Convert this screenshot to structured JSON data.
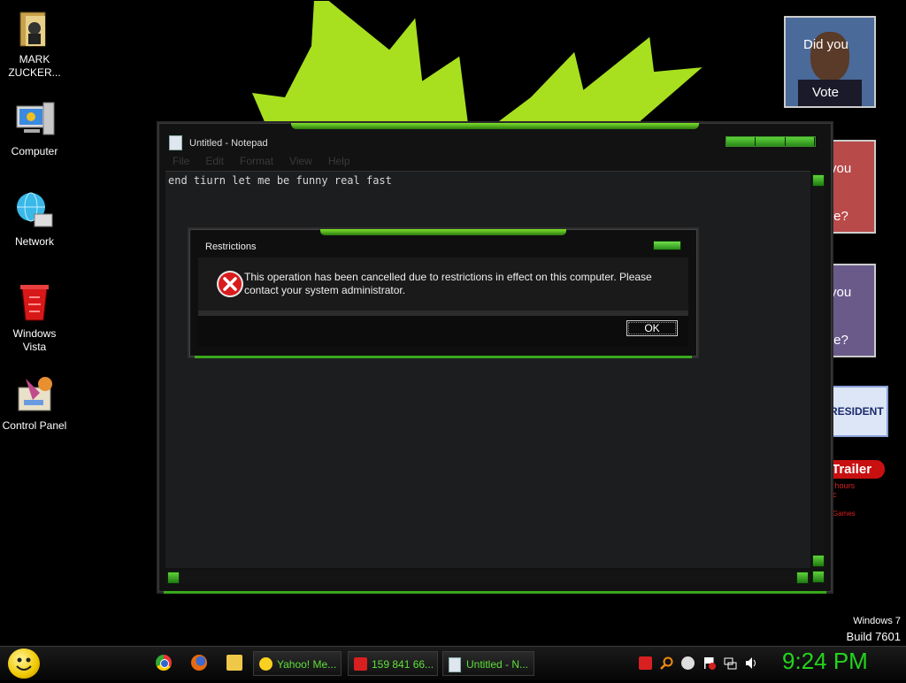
{
  "desktop": {
    "icons": [
      {
        "label": "MARK ZUCKER...",
        "icon": "folder-person-icon"
      },
      {
        "label": "Computer",
        "icon": "computer-icon"
      },
      {
        "label": "Network",
        "icon": "network-globe-icon"
      },
      {
        "label": "Windows Vista",
        "icon": "recycle-bin-icon"
      },
      {
        "label": "Control Panel",
        "icon": "control-panel-icon"
      }
    ],
    "gadgets": {
      "ad1_line1": "Did you",
      "ad1_line2": "Vote",
      "ad2_line1": "you",
      "ad2_line2": "te?",
      "ad3_line1": "you",
      "ad3_line2": "te?",
      "banner": "RESIDENT",
      "trailer": "Trailer",
      "trailer_sub1": "8 hours",
      "trailer_sub2": "ac",
      "trailer_sub3": "r Games"
    },
    "watermark": {
      "line1": "Windows 7",
      "line2": "Build 7601"
    }
  },
  "notepad": {
    "title": "Untitled - Notepad",
    "menu": [
      "File",
      "Edit",
      "Format",
      "View",
      "Help"
    ],
    "content": "end tiurn let me be funny real fast"
  },
  "dialog": {
    "title": "Restrictions",
    "message": "This operation has been cancelled due to restrictions in effect on this computer. Please contact your system administrator.",
    "ok_label": "OK",
    "icon": "error-icon"
  },
  "taskbar": {
    "quick_launch": [
      "chrome-icon",
      "firefox-icon",
      "folder-icon"
    ],
    "buttons": [
      {
        "label": "Yahoo! Me...",
        "icon": "yahoo-messenger-icon"
      },
      {
        "label": "159 841 66...",
        "icon": "media-player-icon"
      },
      {
        "label": "Untitled - N...",
        "icon": "notepad-icon"
      }
    ],
    "clock": "9:24 PM"
  },
  "colors": {
    "accent": "#5fe03a",
    "clock": "#22d51c",
    "wallpaper_spike": "#a8e020"
  }
}
